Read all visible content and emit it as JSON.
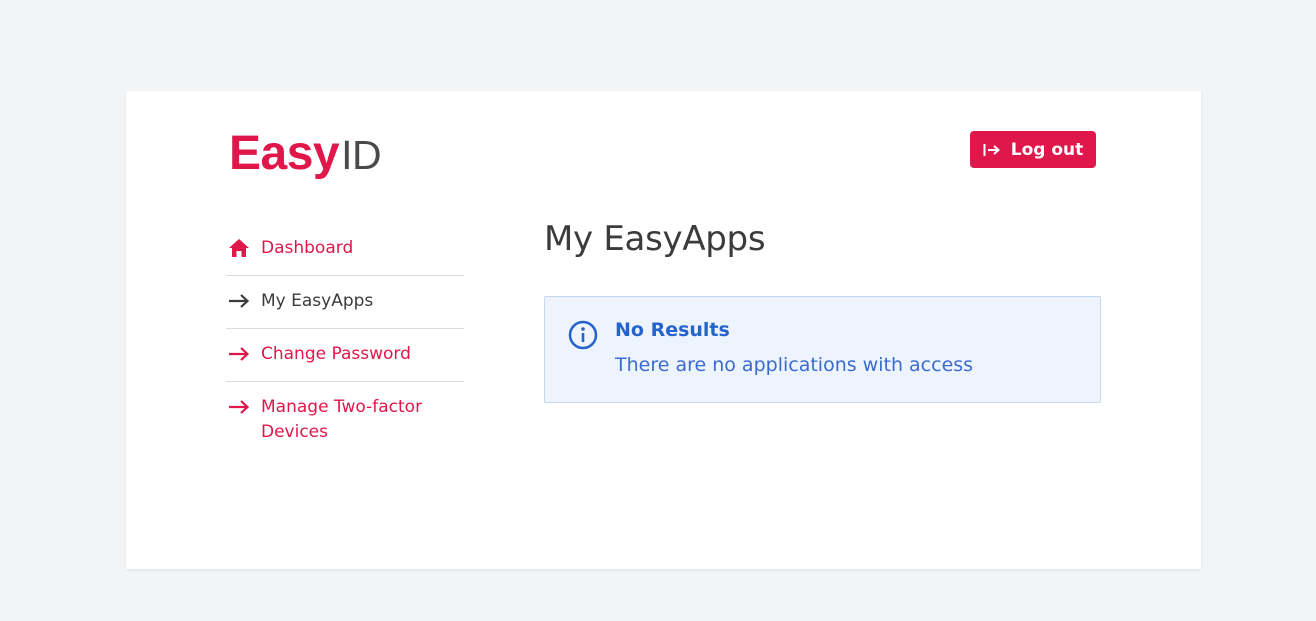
{
  "brand": {
    "logo_easy": "Easy",
    "logo_id": "ID",
    "accent_color": "#e0174a",
    "text_color": "#3b3b3b"
  },
  "header": {
    "logout_label": "Log out",
    "logout_icon": "sign-out-icon"
  },
  "sidebar": {
    "items": [
      {
        "label": "Dashboard",
        "icon": "home-icon",
        "active": false
      },
      {
        "label": "My EasyApps",
        "icon": "arrow-right-icon",
        "active": true
      },
      {
        "label": "Change Password",
        "icon": "arrow-right-icon",
        "active": false
      },
      {
        "label": "Manage Two-factor Devices",
        "icon": "arrow-right-icon",
        "active": false
      }
    ]
  },
  "main": {
    "title": "My EasyApps",
    "alert": {
      "icon": "info-icon",
      "title": "No Results",
      "message": "There are no applications with access",
      "color": "#2563cc"
    }
  }
}
